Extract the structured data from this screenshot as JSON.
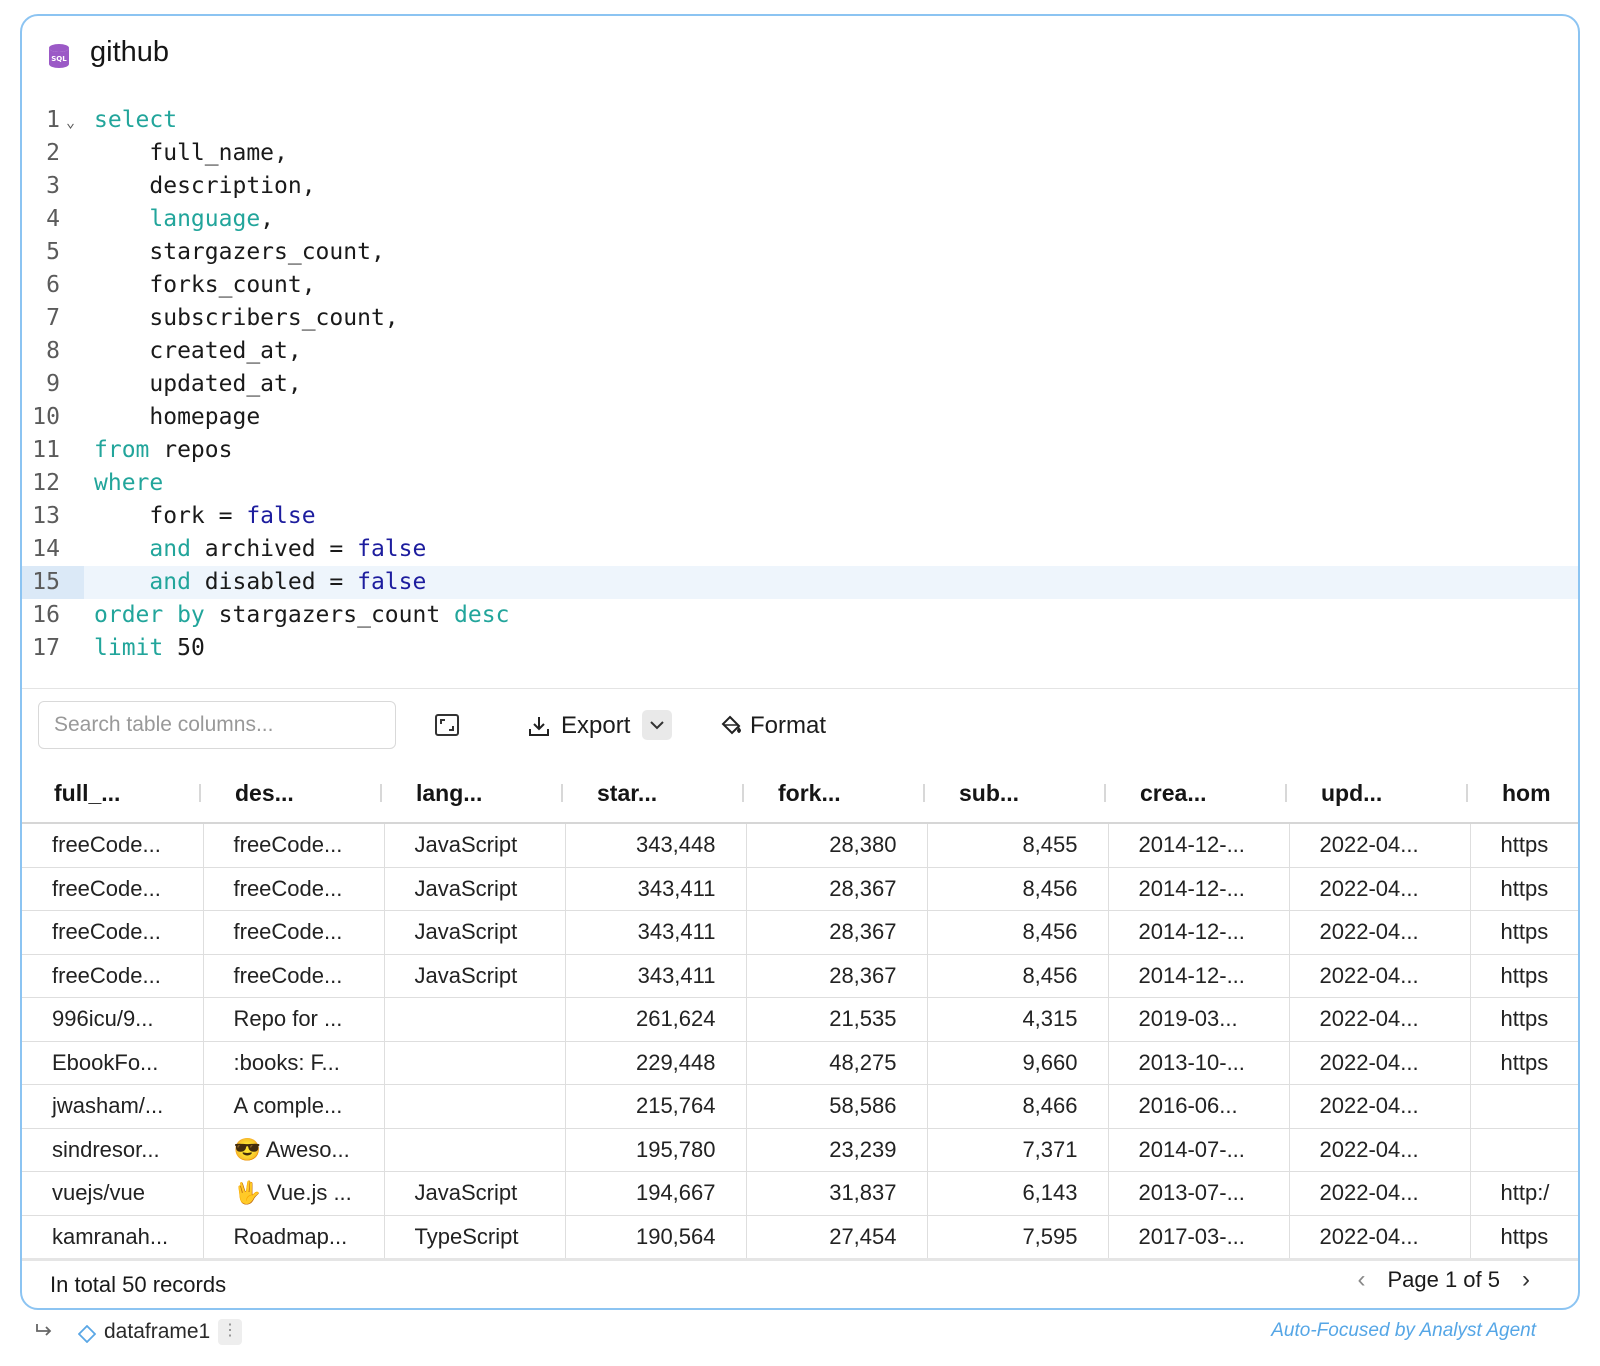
{
  "cell": {
    "title": "github",
    "icon": "sql-database-icon"
  },
  "editor": {
    "active_line": 15,
    "lines": [
      {
        "n": "1",
        "tokens": [
          {
            "t": "select",
            "c": "kw"
          }
        ],
        "fold": true
      },
      {
        "n": "2",
        "tokens": [
          {
            "t": "    full_name,",
            "c": ""
          }
        ]
      },
      {
        "n": "3",
        "tokens": [
          {
            "t": "    description,",
            "c": ""
          }
        ]
      },
      {
        "n": "4",
        "tokens": [
          {
            "t": "    ",
            "c": ""
          },
          {
            "t": "language",
            "c": "kw"
          },
          {
            "t": ",",
            "c": ""
          }
        ]
      },
      {
        "n": "5",
        "tokens": [
          {
            "t": "    stargazers_count,",
            "c": ""
          }
        ]
      },
      {
        "n": "6",
        "tokens": [
          {
            "t": "    forks_count,",
            "c": ""
          }
        ]
      },
      {
        "n": "7",
        "tokens": [
          {
            "t": "    subscribers_count,",
            "c": ""
          }
        ]
      },
      {
        "n": "8",
        "tokens": [
          {
            "t": "    created_at,",
            "c": ""
          }
        ]
      },
      {
        "n": "9",
        "tokens": [
          {
            "t": "    updated_at,",
            "c": ""
          }
        ]
      },
      {
        "n": "10",
        "tokens": [
          {
            "t": "    homepage",
            "c": ""
          }
        ]
      },
      {
        "n": "11",
        "tokens": [
          {
            "t": "from",
            "c": "kw"
          },
          {
            "t": " repos",
            "c": ""
          }
        ]
      },
      {
        "n": "12",
        "tokens": [
          {
            "t": "where",
            "c": "kw"
          }
        ]
      },
      {
        "n": "13",
        "tokens": [
          {
            "t": "    fork = ",
            "c": ""
          },
          {
            "t": "false",
            "c": "bool"
          }
        ]
      },
      {
        "n": "14",
        "tokens": [
          {
            "t": "    ",
            "c": ""
          },
          {
            "t": "and",
            "c": "kw"
          },
          {
            "t": " archived = ",
            "c": ""
          },
          {
            "t": "false",
            "c": "bool"
          }
        ]
      },
      {
        "n": "15",
        "tokens": [
          {
            "t": "    ",
            "c": ""
          },
          {
            "t": "and",
            "c": "kw"
          },
          {
            "t": " disabled = ",
            "c": ""
          },
          {
            "t": "false",
            "c": "bool"
          }
        ]
      },
      {
        "n": "16",
        "tokens": [
          {
            "t": "order by",
            "c": "kw"
          },
          {
            "t": " stargazers_count ",
            "c": ""
          },
          {
            "t": "desc",
            "c": "kw"
          }
        ]
      },
      {
        "n": "17",
        "tokens": [
          {
            "t": "limit",
            "c": "kw"
          },
          {
            "t": " 50",
            "c": "num"
          }
        ]
      }
    ]
  },
  "toolbar": {
    "search_placeholder": "Search table columns...",
    "export_label": "Export",
    "format_label": "Format"
  },
  "table": {
    "columns": [
      "full_...",
      "des...",
      "lang...",
      "star...",
      "fork...",
      "sub...",
      "crea...",
      "upd...",
      "hom"
    ],
    "numeric_columns": [
      3,
      4,
      5
    ],
    "rows": [
      [
        "freeCode...",
        "freeCode...",
        "JavaScript",
        "343,448",
        "28,380",
        "8,455",
        "2014-12-...",
        "2022-04...",
        "https"
      ],
      [
        "freeCode...",
        "freeCode...",
        "JavaScript",
        "343,411",
        "28,367",
        "8,456",
        "2014-12-...",
        "2022-04...",
        "https"
      ],
      [
        "freeCode...",
        "freeCode...",
        "JavaScript",
        "343,411",
        "28,367",
        "8,456",
        "2014-12-...",
        "2022-04...",
        "https"
      ],
      [
        "freeCode...",
        "freeCode...",
        "JavaScript",
        "343,411",
        "28,367",
        "8,456",
        "2014-12-...",
        "2022-04...",
        "https"
      ],
      [
        "996icu/9...",
        "Repo for ...",
        "",
        "261,624",
        "21,535",
        "4,315",
        "2019-03...",
        "2022-04...",
        "https"
      ],
      [
        "EbookFo...",
        ":books: F...",
        "",
        "229,448",
        "48,275",
        "9,660",
        "2013-10-...",
        "2022-04...",
        "https"
      ],
      [
        "jwasham/...",
        "A comple...",
        "",
        "215,764",
        "58,586",
        "8,466",
        "2016-06...",
        "2022-04...",
        ""
      ],
      [
        "sindresor...",
        "😎 Aweso...",
        "",
        "195,780",
        "23,239",
        "7,371",
        "2014-07-...",
        "2022-04...",
        ""
      ],
      [
        "vuejs/vue",
        "🖖 Vue.js ...",
        "JavaScript",
        "194,667",
        "31,837",
        "6,143",
        "2013-07-...",
        "2022-04...",
        "http:/"
      ],
      [
        "kamranah...",
        "Roadmap...",
        "TypeScript",
        "190,564",
        "27,454",
        "7,595",
        "2017-03-...",
        "2022-04...",
        "https"
      ]
    ]
  },
  "footer": {
    "total": "In total 50 records",
    "page": "Page 1 of 5"
  },
  "output": {
    "dataframe": "dataframe1",
    "agent_note": "Auto-Focused by Analyst Agent"
  },
  "colors": {
    "keyword": "#22a59b",
    "boolean": "#1d1d9e",
    "card_border": "#8cc4f2",
    "active_line": "#eef5fc",
    "agent_note": "#55a6e6"
  }
}
